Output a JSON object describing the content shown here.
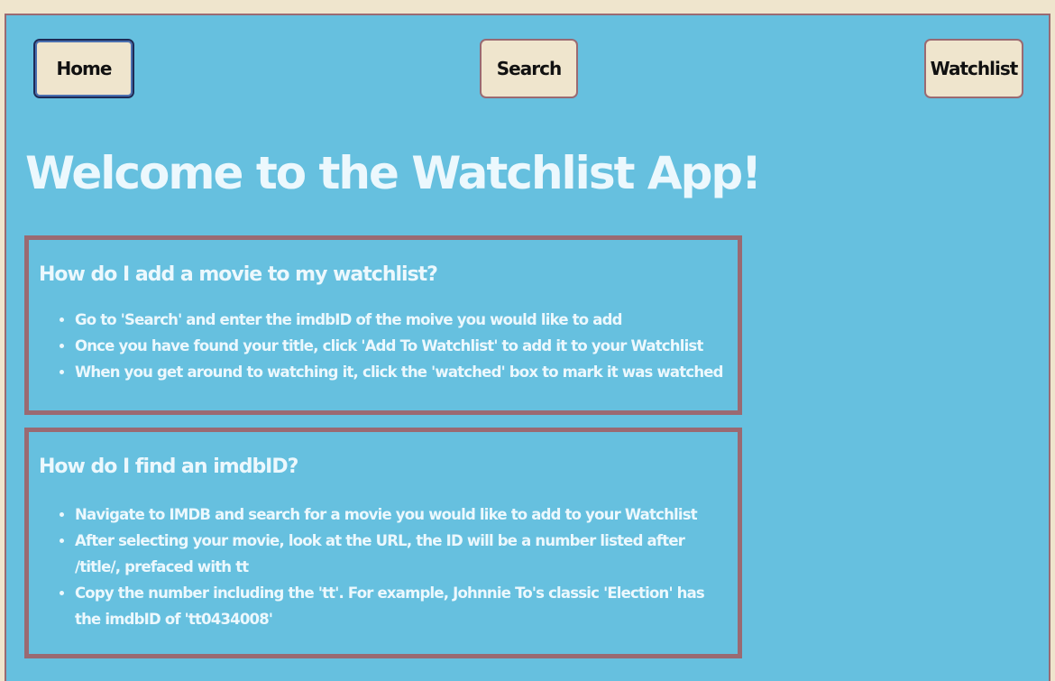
{
  "nav": {
    "home_label": "Home",
    "search_label": "Search",
    "watchlist_label": "Watchlist"
  },
  "main": {
    "title": "Welcome to the Watchlist App!",
    "faqs": [
      {
        "question": "How do I add a movie to my watchlist?",
        "answers": [
          "Go to 'Search' and enter the imdbID of the moive you would like to add",
          "Once you have found your title, click 'Add To Watchlist' to add it to your Watchlist",
          "When you get around to watching it, click the 'watched' box to mark it was watched"
        ]
      },
      {
        "question": "How do I find an imdbID?",
        "answers": [
          "Navigate to IMDB and search for a movie you would like to add to your Watchlist",
          "After selecting your movie, look at the URL, the ID will be a number listed after /title/, prefaced with tt",
          "Copy the number including the 'tt'. For example, Johnnie To's classic 'Election' has the imdbID of 'tt0434008'"
        ]
      }
    ]
  },
  "colors": {
    "background": "#66c0df",
    "page_bg": "#efe5cd",
    "button_bg": "#efe5cd",
    "border": "#9a6a72",
    "text_light": "#ecf8fd"
  }
}
